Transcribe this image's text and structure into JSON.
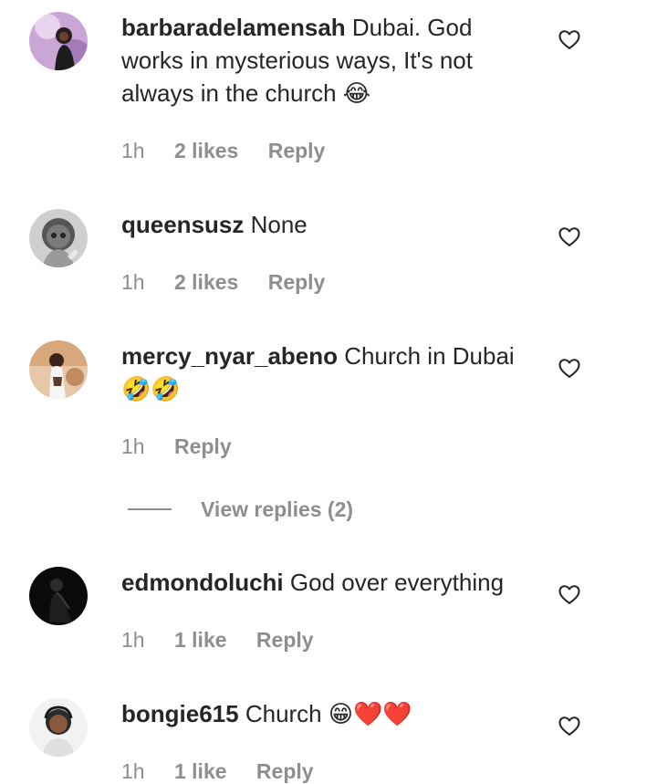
{
  "comments": [
    {
      "username": "barbaradelamensah",
      "text": "Dubai. God works in mysterious ways, It's not always in the church 😂",
      "time": "1h",
      "likes": "2 likes",
      "reply": "Reply"
    },
    {
      "username": "queensusz",
      "text": "None",
      "time": "1h",
      "likes": "2 likes",
      "reply": "Reply"
    },
    {
      "username": "mercy_nyar_abeno",
      "text": "Church in Dubai 🤣🤣",
      "time": "1h",
      "reply": "Reply",
      "view_replies": "View replies (2)"
    },
    {
      "username": "edmondoluchi",
      "text": "God over everything",
      "time": "1h",
      "likes": "1 like",
      "reply": "Reply"
    },
    {
      "username": "bongie615",
      "text": "Church 😁❤️❤️",
      "time": "1h",
      "likes": "1 like",
      "reply": "Reply"
    }
  ],
  "icons": {
    "like": "heart-outline-icon"
  },
  "colors": {
    "text": "#262626",
    "secondary": "#8e8e8e"
  }
}
